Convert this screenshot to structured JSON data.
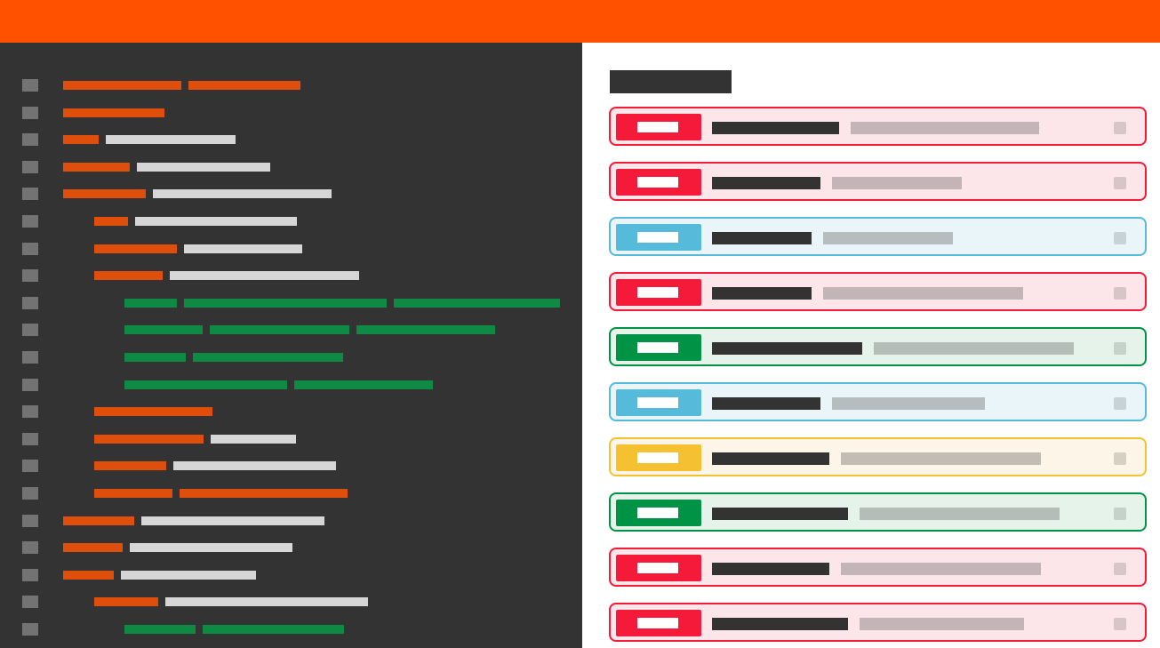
{
  "colors": {
    "topbar": "#ff5100",
    "editor_bg": "#333333",
    "gutter_mark": "#737373",
    "keyword": "#e04e0c",
    "text": "#d6d6d6",
    "string": "#0e8a45",
    "title_bar": "#333333",
    "placeholder": "#c3b7b7"
  },
  "severity": {
    "critical": {
      "accent": "#f5193a",
      "bg": "#fde6e9",
      "desc": "#c2b4b7",
      "check": "#d8c5c8"
    },
    "info": {
      "accent": "#56bada",
      "bg": "#e9f5f9",
      "desc": "#b6bdbf",
      "check": "#c6d2d6"
    },
    "success": {
      "accent": "#009245",
      "bg": "#e6f3eb",
      "desc": "#b5bdb9",
      "check": "#c4d2ca"
    },
    "warning": {
      "accent": "#f6c130",
      "bg": "#fdf6e8",
      "desc": "#c2bdb3",
      "check": "#d6d0c3"
    }
  },
  "issues": [
    {
      "severity": "critical",
      "title_width": 143,
      "desc_width": 212
    },
    {
      "severity": "critical",
      "title_width": 122,
      "desc_width": 146
    },
    {
      "severity": "info",
      "title_width": 112,
      "desc_width": 146
    },
    {
      "severity": "critical",
      "title_width": 112,
      "desc_width": 225
    },
    {
      "severity": "success",
      "title_width": 169,
      "desc_width": 225
    },
    {
      "severity": "info",
      "title_width": 122,
      "desc_width": 172
    },
    {
      "severity": "warning",
      "title_width": 132,
      "desc_width": 225
    },
    {
      "severity": "success",
      "title_width": 153,
      "desc_width": 225
    },
    {
      "severity": "critical",
      "title_width": 132,
      "desc_width": 225
    },
    {
      "severity": "critical",
      "title_width": 153,
      "desc_width": 185
    }
  ],
  "code_lines": [
    {
      "indent": 0,
      "segments": [
        [
          "keyword",
          133
        ],
        [
          "keyword",
          126
        ]
      ]
    },
    {
      "indent": 0,
      "segments": [
        [
          "keyword",
          114
        ]
      ]
    },
    {
      "indent": 0,
      "segments": [
        [
          "keyword",
          40
        ],
        [
          "text",
          146
        ]
      ]
    },
    {
      "indent": 0,
      "segments": [
        [
          "keyword",
          75
        ],
        [
          "text",
          150
        ]
      ]
    },
    {
      "indent": 0,
      "segments": [
        [
          "keyword",
          93
        ],
        [
          "text",
          201
        ]
      ]
    },
    {
      "indent": 1,
      "segments": [
        [
          "keyword",
          38
        ],
        [
          "text",
          182
        ]
      ]
    },
    {
      "indent": 1,
      "segments": [
        [
          "keyword",
          93
        ],
        [
          "text",
          133
        ]
      ]
    },
    {
      "indent": 1,
      "segments": [
        [
          "keyword",
          77
        ],
        [
          "text",
          213
        ]
      ]
    },
    {
      "indent": 2,
      "segments": [
        [
          "string",
          59
        ],
        [
          "string",
          228
        ],
        [
          "string",
          187
        ]
      ]
    },
    {
      "indent": 2,
      "segments": [
        [
          "string",
          88
        ],
        [
          "string",
          157
        ],
        [
          "string",
          156
        ]
      ]
    },
    {
      "indent": 2,
      "segments": [
        [
          "string",
          69
        ],
        [
          "string",
          169
        ]
      ]
    },
    {
      "indent": 2,
      "segments": [
        [
          "string",
          183
        ],
        [
          "string",
          156
        ]
      ]
    },
    {
      "indent": 1,
      "segments": [
        [
          "keyword",
          133
        ]
      ]
    },
    {
      "indent": 1,
      "segments": [
        [
          "keyword",
          123
        ],
        [
          "text",
          96
        ]
      ]
    },
    {
      "indent": 1,
      "segments": [
        [
          "keyword",
          81
        ],
        [
          "text",
          183
        ]
      ]
    },
    {
      "indent": 1,
      "segments": [
        [
          "keyword",
          88
        ],
        [
          "keyword",
          189
        ]
      ]
    },
    {
      "indent": 0,
      "segments": [
        [
          "keyword",
          80
        ],
        [
          "text",
          206
        ]
      ]
    },
    {
      "indent": 0,
      "segments": [
        [
          "keyword",
          67
        ],
        [
          "text",
          183
        ]
      ]
    },
    {
      "indent": 0,
      "segments": [
        [
          "keyword",
          57
        ],
        [
          "text",
          152
        ]
      ]
    },
    {
      "indent": 1,
      "segments": [
        [
          "keyword",
          72
        ],
        [
          "text",
          228
        ]
      ]
    },
    {
      "indent": 2,
      "segments": [
        [
          "string",
          80
        ],
        [
          "string",
          159
        ]
      ]
    }
  ]
}
